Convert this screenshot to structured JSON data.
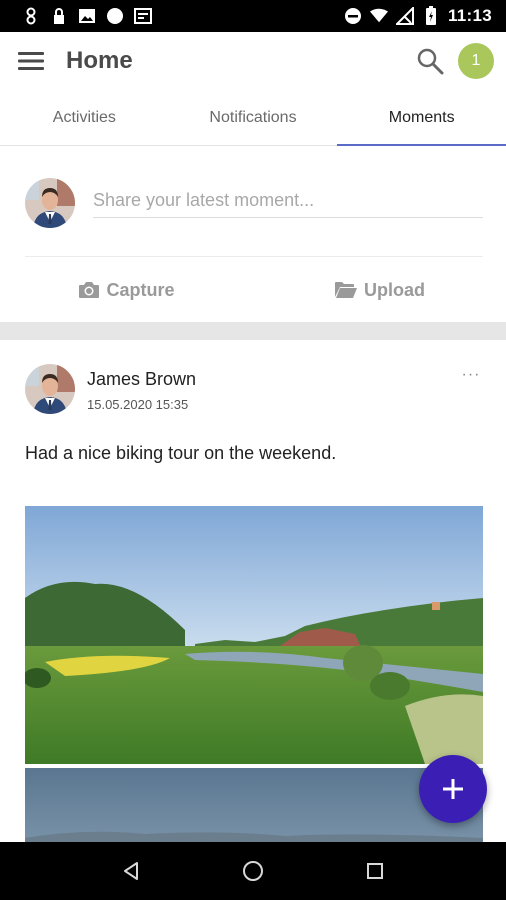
{
  "status_bar": {
    "time": "11:13",
    "left_icons": [
      "notification-icon",
      "lock-icon",
      "image-icon",
      "circle-icon",
      "card-icon"
    ],
    "right_icons": [
      "do-not-disturb-icon",
      "wifi-icon",
      "no-signal-icon",
      "battery-icon"
    ]
  },
  "app_bar": {
    "title": "Home",
    "badge_text": "1",
    "badge_color": "#a9c75b"
  },
  "tabs": [
    {
      "label": "Activities",
      "active": false
    },
    {
      "label": "Notifications",
      "active": false
    },
    {
      "label": "Moments",
      "active": true
    }
  ],
  "composer": {
    "placeholder": "Share your latest moment...",
    "capture_label": "Capture",
    "upload_label": "Upload"
  },
  "post": {
    "author": "James Brown",
    "timestamp": "15.05.2020 15:35",
    "text": "Had a nice biking tour on the weekend.",
    "more_label": "···"
  },
  "colors": {
    "accent": "#5b6bc8",
    "fab": "#3b1fb5"
  }
}
